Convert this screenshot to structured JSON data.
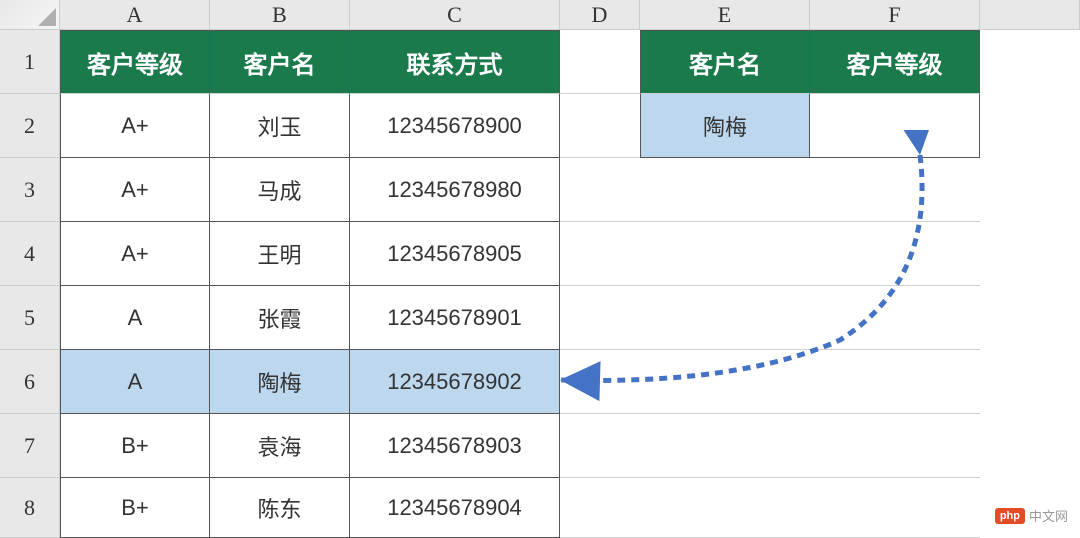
{
  "columns": [
    "A",
    "B",
    "C",
    "D",
    "E",
    "F"
  ],
  "rows": [
    "1",
    "2",
    "3",
    "4",
    "5",
    "6",
    "7",
    "8"
  ],
  "table1": {
    "headers": [
      "客户等级",
      "客户名",
      "联系方式"
    ],
    "data": [
      {
        "grade": "A+",
        "name": "刘玉",
        "contact": "12345678900"
      },
      {
        "grade": "A+",
        "name": "马成",
        "contact": "12345678980"
      },
      {
        "grade": "A+",
        "name": "王明",
        "contact": "12345678905"
      },
      {
        "grade": "A",
        "name": "张霞",
        "contact": "12345678901"
      },
      {
        "grade": "A",
        "name": "陶梅",
        "contact": "12345678902"
      },
      {
        "grade": "B+",
        "name": "袁海",
        "contact": "12345678903"
      },
      {
        "grade": "B+",
        "name": "陈东",
        "contact": "12345678904"
      }
    ]
  },
  "table2": {
    "headers": [
      "客户名",
      "客户等级"
    ],
    "data": [
      {
        "name": "陶梅",
        "grade": ""
      }
    ]
  },
  "watermark": {
    "badge": "php",
    "text": "中文网"
  }
}
